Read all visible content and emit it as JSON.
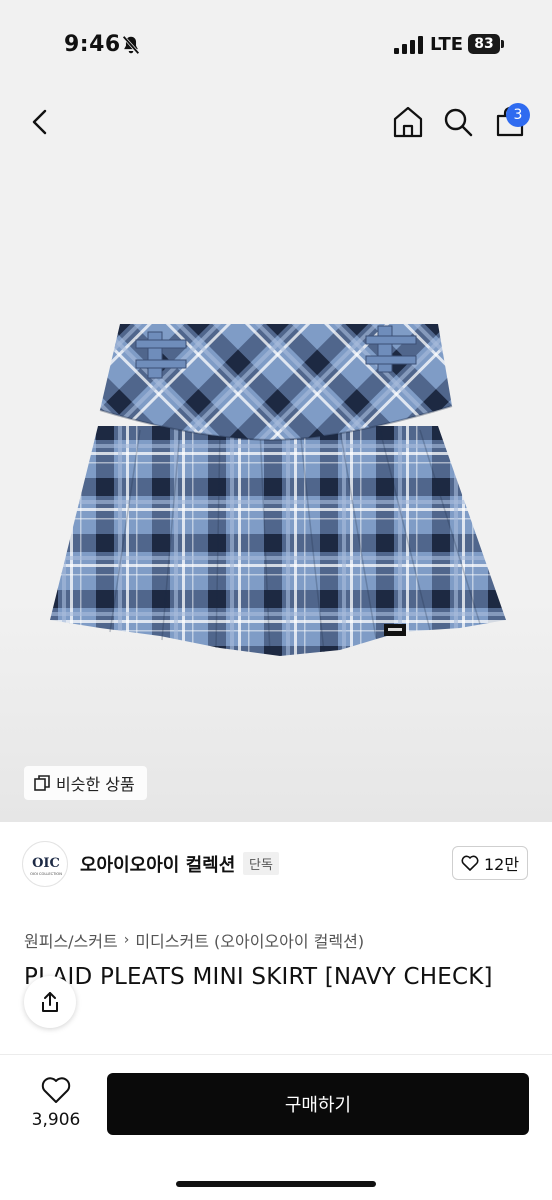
{
  "status_bar": {
    "time": "9:46",
    "network": "LTE",
    "battery": "83"
  },
  "nav": {
    "cart_badge": "3"
  },
  "product_image": {
    "similar_label": "비슷한 상품"
  },
  "shop": {
    "name": "오아이오아이 컬렉션",
    "tag": "단독",
    "likes": "12만",
    "logo_text": "OIC",
    "logo_sub": "OIOI COLLECTION"
  },
  "breadcrumb": {
    "category": "원피스/스커트",
    "subcategory": "미디스커트 (오아이오아이 컬렉션)"
  },
  "product": {
    "title": "PLAID PLEATS MINI SKIRT [NAVY CHECK]"
  },
  "bottom_bar": {
    "wish_count": "3,906",
    "buy_label": "구매하기"
  },
  "colors": {
    "accent_badge": "#2f6bf0",
    "buy_button": "#0a0a0a",
    "plaid_base": "#7f9cc6",
    "plaid_dark": "#1d2a45"
  },
  "icons": [
    "chevron-left-icon",
    "home-icon",
    "search-icon",
    "shopping-bag-icon",
    "copy-icon",
    "heart-icon",
    "share-icon",
    "bell-off-icon",
    "signal-icon",
    "battery-icon"
  ]
}
